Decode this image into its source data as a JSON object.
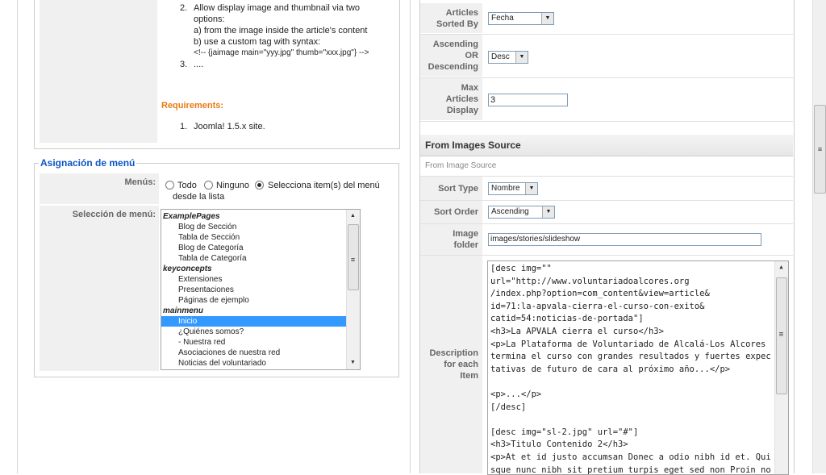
{
  "description": {
    "item2_line1": "Allow display image and thumbnail via two",
    "item2_line2": "options:",
    "item2_a": "a) from the image inside the article's content",
    "item2_b": "b) use a custom tag with syntax:",
    "item2_code": "<!-- {jaimage main=\"yyy.jpg\" thumb=\"xxx.jpg\"} -->",
    "item3": "....",
    "requirements_label": "Requirements:",
    "req_item": "Joomla! 1.5.x site.",
    "num2": "2.",
    "num3": "3.",
    "num1": "1."
  },
  "menu_assignment": {
    "legend": "Asignación de menú",
    "menus_label": "Menús:",
    "radio_all": "Todo",
    "radio_none": "Ninguno",
    "radio_select_1": "Selecciona item(s) del menú",
    "radio_select_2": "desde la lista",
    "selection_label": "Selección de menú:",
    "list_items": [
      {
        "text": "ExamplePages",
        "type": "group"
      },
      {
        "text": "Blog de Sección",
        "type": "item"
      },
      {
        "text": "Tabla de Sección",
        "type": "item"
      },
      {
        "text": "Blog de Categoría",
        "type": "item"
      },
      {
        "text": "Tabla de Categoría",
        "type": "item"
      },
      {
        "text": "keyconcepts",
        "type": "group"
      },
      {
        "text": "Extensiones",
        "type": "item"
      },
      {
        "text": "Presentaciones",
        "type": "item"
      },
      {
        "text": "Páginas de ejemplo",
        "type": "item"
      },
      {
        "text": "mainmenu",
        "type": "group"
      },
      {
        "text": "Inicio",
        "type": "item",
        "selected": true
      },
      {
        "text": "¿Quiénes somos?",
        "type": "item"
      },
      {
        "text": " - Nuestra red",
        "type": "item"
      },
      {
        "text": "Asociaciones de nuestra red",
        "type": "item"
      },
      {
        "text": "Noticias del voluntariado",
        "type": "item"
      }
    ]
  },
  "params": {
    "articles_sorted_by_label_1": "Articles",
    "articles_sorted_by_label_2": "Sorted By",
    "articles_sorted_by_value": "Fecha",
    "asc_desc_label_1": "Ascending",
    "asc_desc_label_2": "OR",
    "asc_desc_label_3": "Descending",
    "asc_desc_value": "Desc",
    "max_articles_label_1": "Max",
    "max_articles_label_2": "Articles",
    "max_articles_label_3": "Display",
    "max_articles_value": "3",
    "section_title": "From Images Source",
    "section_subtitle": "From Image Source",
    "sort_type_label": "Sort Type",
    "sort_type_value": "Nombre",
    "sort_order_label": "Sort Order",
    "sort_order_value": "Ascending",
    "image_folder_label_1": "Image",
    "image_folder_label_2": "folder",
    "image_folder_value": "images/stories/slideshow",
    "desc_label_1": "Description",
    "desc_label_2": "for each",
    "desc_label_3": "Item",
    "desc_value": "[desc img=\"\"\nurl=\"http://www.voluntariadoalcores.org\n/index.php?option=com_content&view=article&\nid=71:la-apvala-cierra-el-curso-con-exito&\ncatid=54:noticias-de-portada\"]\n<h3>La APVALA cierra el curso</h3>\n<p>La Plataforma de Voluntariado de Alcalá-Los Alcores termina el curso con grandes resultados y fuertes expectativas de futuro de cara al próximo año...</p>\n\n<p>...</p>\n[/desc]\n\n[desc img=\"sl-2.jpg\" url=\"#\"]\n<h3>Titulo Contenido 2</h3>\n<p>At et id justo accumsan Donec a odio nibh id et. Quisque nunc nibh sit pretium turpis eget sed non Proin non. Justo id pede Vestibulum ornare"
  },
  "icons": {
    "arrow_down": "▼",
    "arrow_up": "▲",
    "grip": "≡"
  }
}
